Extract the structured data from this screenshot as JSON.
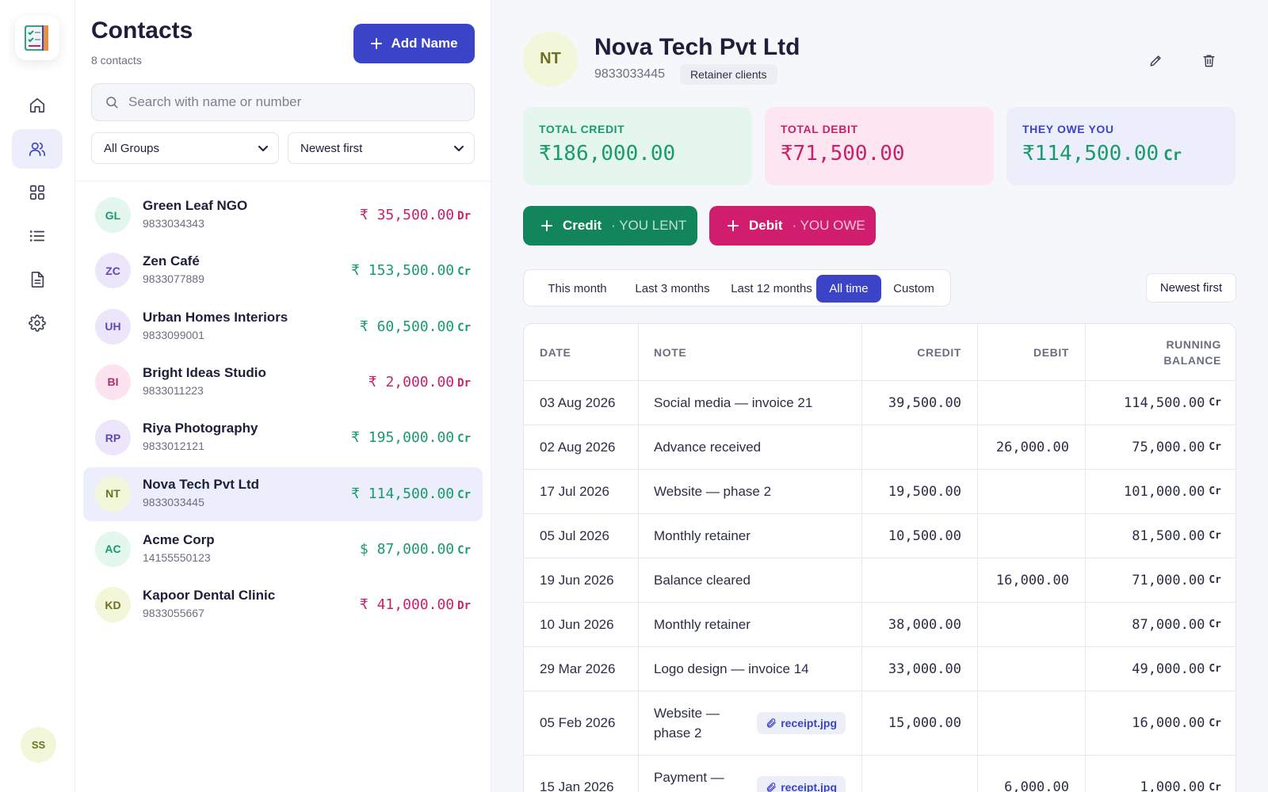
{
  "app": {
    "nav": [
      "home-icon",
      "contacts-icon",
      "grid-icon",
      "list-icon",
      "document-icon",
      "gear-icon"
    ],
    "active_nav": "contacts-icon",
    "user_initials": "SS"
  },
  "contacts_panel": {
    "title": "Contacts",
    "count": "8 contacts",
    "add_button": "Add Name",
    "search_placeholder": "Search with name or number",
    "group_filter": "All Groups",
    "sort": "Newest first",
    "items": [
      {
        "initials": "GL",
        "name": "Green Leaf NGO",
        "phone": "9833034343",
        "currency": "₹",
        "amount": "35,500.00",
        "tag": "Dr",
        "avatar_bg": "#e3f7ec",
        "avatar_fg": "#1a9b6c"
      },
      {
        "initials": "ZC",
        "name": "Zen Café",
        "phone": "9833077889",
        "currency": "₹",
        "amount": "153,500.00",
        "tag": "Cr",
        "avatar_bg": "#ece6fb",
        "avatar_fg": "#5b49b8"
      },
      {
        "initials": "UH",
        "name": "Urban Homes Interiors",
        "phone": "9833099001",
        "currency": "₹",
        "amount": "60,500.00",
        "tag": "Cr",
        "avatar_bg": "#ece6fb",
        "avatar_fg": "#5b49b8"
      },
      {
        "initials": "BI",
        "name": "Bright Ideas Studio",
        "phone": "9833011223",
        "currency": "₹",
        "amount": "2,000.00",
        "tag": "Dr",
        "avatar_bg": "#fbe4ef",
        "avatar_fg": "#b02c6c"
      },
      {
        "initials": "RP",
        "name": "Riya Photography",
        "phone": "9833012121",
        "currency": "₹",
        "amount": "195,000.00",
        "tag": "Cr",
        "avatar_bg": "#ece6fb",
        "avatar_fg": "#5b49b8"
      },
      {
        "initials": "NT",
        "name": "Nova Tech Pvt Ltd",
        "phone": "9833033445",
        "currency": "₹",
        "amount": "114,500.00",
        "tag": "Cr",
        "avatar_bg": "#f3f7d9",
        "avatar_fg": "#6d6f25"
      },
      {
        "initials": "AC",
        "name": "Acme Corp",
        "phone": "14155550123",
        "currency": "$",
        "amount": "87,000.00",
        "tag": "Cr",
        "avatar_bg": "#e3f7ec",
        "avatar_fg": "#1a9b6c"
      },
      {
        "initials": "KD",
        "name": "Kapoor Dental Clinic",
        "phone": "9833055667",
        "currency": "₹",
        "amount": "41,000.00",
        "tag": "Dr",
        "avatar_bg": "#f3f7d9",
        "avatar_fg": "#6d6f25"
      }
    ],
    "selected_index": 5
  },
  "detail": {
    "initials": "NT",
    "name": "Nova Tech Pvt Ltd",
    "phone": "9833033445",
    "group": "Retainer clients",
    "stats": {
      "credit": {
        "label": "TOTAL CREDIT",
        "currency": "₹",
        "value": "186,000.00"
      },
      "debit": {
        "label": "TOTAL DEBIT",
        "currency": "₹",
        "value": "71,500.00"
      },
      "owe": {
        "label": "THEY OWE YOU",
        "currency": "₹",
        "value": "114,500.00",
        "tag": "Cr"
      }
    },
    "credit_button": {
      "label": "Credit",
      "sub": "· YOU LENT"
    },
    "debit_button": {
      "label": "Debit",
      "sub": "· YOU OWE"
    },
    "ranges": [
      "This month",
      "Last 3 months",
      "Last 12 months",
      "All time",
      "Custom"
    ],
    "active_range": "All time",
    "sort": "Newest first",
    "columns": {
      "date": "DATE",
      "note": "NOTE",
      "credit": "CREDIT",
      "debit": "DEBIT",
      "balance_1": "RUNNING",
      "balance_2": "BALANCE"
    },
    "rows": [
      {
        "date": "03 Aug 2026",
        "note": "Social media — invoice 21",
        "credit": "39,500.00",
        "debit": "",
        "balance": "114,500.00",
        "tag": "Cr"
      },
      {
        "date": "02 Aug 2026",
        "note": "Advance received",
        "credit": "",
        "debit": "26,000.00",
        "balance": "75,000.00",
        "tag": "Cr"
      },
      {
        "date": "17 Jul 2026",
        "note": "Website — phase 2",
        "credit": "19,500.00",
        "debit": "",
        "balance": "101,000.00",
        "tag": "Cr"
      },
      {
        "date": "05 Jul 2026",
        "note": "Monthly retainer",
        "credit": "10,500.00",
        "debit": "",
        "balance": "81,500.00",
        "tag": "Cr"
      },
      {
        "date": "19 Jun 2026",
        "note": "Balance cleared",
        "credit": "",
        "debit": "16,000.00",
        "balance": "71,000.00",
        "tag": "Cr"
      },
      {
        "date": "10 Jun 2026",
        "note": "Monthly retainer",
        "credit": "38,000.00",
        "debit": "",
        "balance": "87,000.00",
        "tag": "Cr"
      },
      {
        "date": "29 Mar 2026",
        "note": "Logo design — invoice 14",
        "credit": "33,000.00",
        "debit": "",
        "balance": "49,000.00",
        "tag": "Cr"
      },
      {
        "date": "05 Feb 2026",
        "note": "Website — phase 2",
        "attachment": "receipt.jpg",
        "credit": "15,000.00",
        "debit": "",
        "balance": "16,000.00",
        "tag": "Cr"
      },
      {
        "date": "15 Jan 2026",
        "note": "Payment — received",
        "attachment": "receipt.jpg",
        "credit": "",
        "debit": "6,000.00",
        "balance": "1,000.00",
        "tag": "Cr"
      }
    ]
  },
  "colors": {
    "accent": "#3b44c6",
    "credit": "#1a9b6c",
    "debit": "#cc1f6a",
    "credit_btn": "#13855c",
    "debit_btn": "#d11d6e"
  }
}
